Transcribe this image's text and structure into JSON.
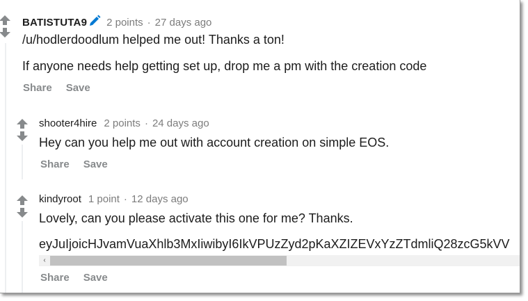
{
  "comments": [
    {
      "author": "BATISTUTA9",
      "points": "2 points",
      "sep": "·",
      "time": "27 days ago",
      "body_lines": [
        "/u/hodlerdoodlum helped me out! Thanks a ton!",
        "If anyone needs help getting set up, drop me a pm with the creation code"
      ],
      "share": "Share",
      "save": "Save"
    },
    {
      "author": "shooter4hire",
      "points": "2 points",
      "sep": "·",
      "time": "24 days ago",
      "body_lines": [
        "Hey can you help me out with account creation on simple EOS."
      ],
      "share": "Share",
      "save": "Save"
    },
    {
      "author": "kindyroot",
      "points": "1 point",
      "sep": "·",
      "time": "12 days ago",
      "body_lines": [
        "Lovely, can you please activate this one for me? Thanks."
      ],
      "code": "eyJuIjoicHJvamVuaXhlb3MxIiwibyI6IkVPUzZyd2pKaXZIZEVxYzZTdmliQ28zcG5kVV",
      "scroll_left": "‹",
      "share": "Share",
      "save": "Save"
    }
  ],
  "colors": {
    "arrow": "#878a8c",
    "pen": "#0079d3",
    "meta": "#7c7c7c"
  },
  "icons": [
    "upvote-icon",
    "downvote-icon",
    "pencil-flair-icon",
    "scroll-left-icon"
  ]
}
